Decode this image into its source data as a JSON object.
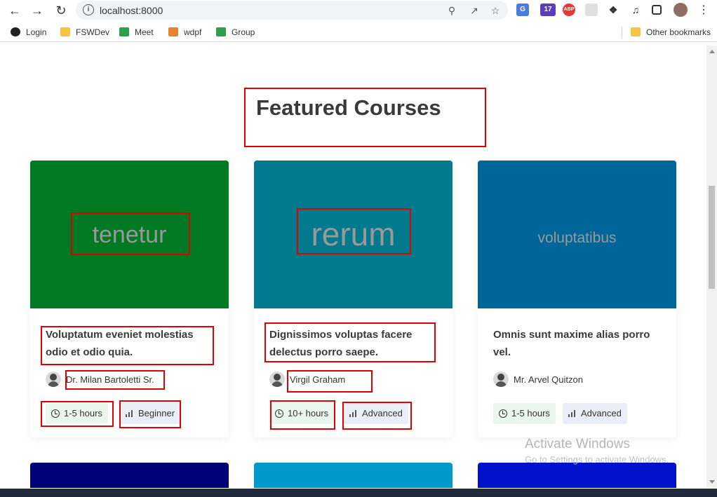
{
  "browser": {
    "url": "localhost:8000",
    "bookmarks": [
      {
        "label": "Login",
        "icon": "github-icon"
      },
      {
        "label": "FSWDev",
        "icon": "folder-icon"
      },
      {
        "label": "Meet",
        "icon": "google-meet-icon"
      },
      {
        "label": "wdpf",
        "icon": "wdpf-icon"
      },
      {
        "label": "Group",
        "icon": "google-meet-icon"
      }
    ],
    "other_bookmarks": "Other bookmarks",
    "extension_badges": {
      "badge_17": "17",
      "abp": "ABP"
    }
  },
  "section": {
    "title": "Featured Courses"
  },
  "courses": [
    {
      "thumb_text": "tenetur",
      "thumb_color": "#007a22",
      "title": "Voluptatum eveniet molestias odio et odio quia.",
      "instructor": "Dr. Milan Bartoletti Sr.",
      "duration": "1-5 hours",
      "level": "Beginner"
    },
    {
      "thumb_text": "rerum",
      "thumb_color": "#007a8c",
      "title": "Dignissimos voluptas facere delectus porro saepe.",
      "instructor": "Virgil Graham",
      "duration": "10+ hours",
      "level": "Advanced"
    },
    {
      "thumb_text": "voluptatibus",
      "thumb_color": "#00669a",
      "title": "Omnis sunt maxime alias porro vel.",
      "instructor": "Mr. Arvel Quitzon",
      "duration": "1-5 hours",
      "level": "Advanced"
    }
  ],
  "next_row_colors": [
    "#000077",
    "#0099cc",
    "#0011cc"
  ],
  "watermark": {
    "line1": "Activate Windows",
    "line2": "Go to Settings to activate Windows."
  }
}
